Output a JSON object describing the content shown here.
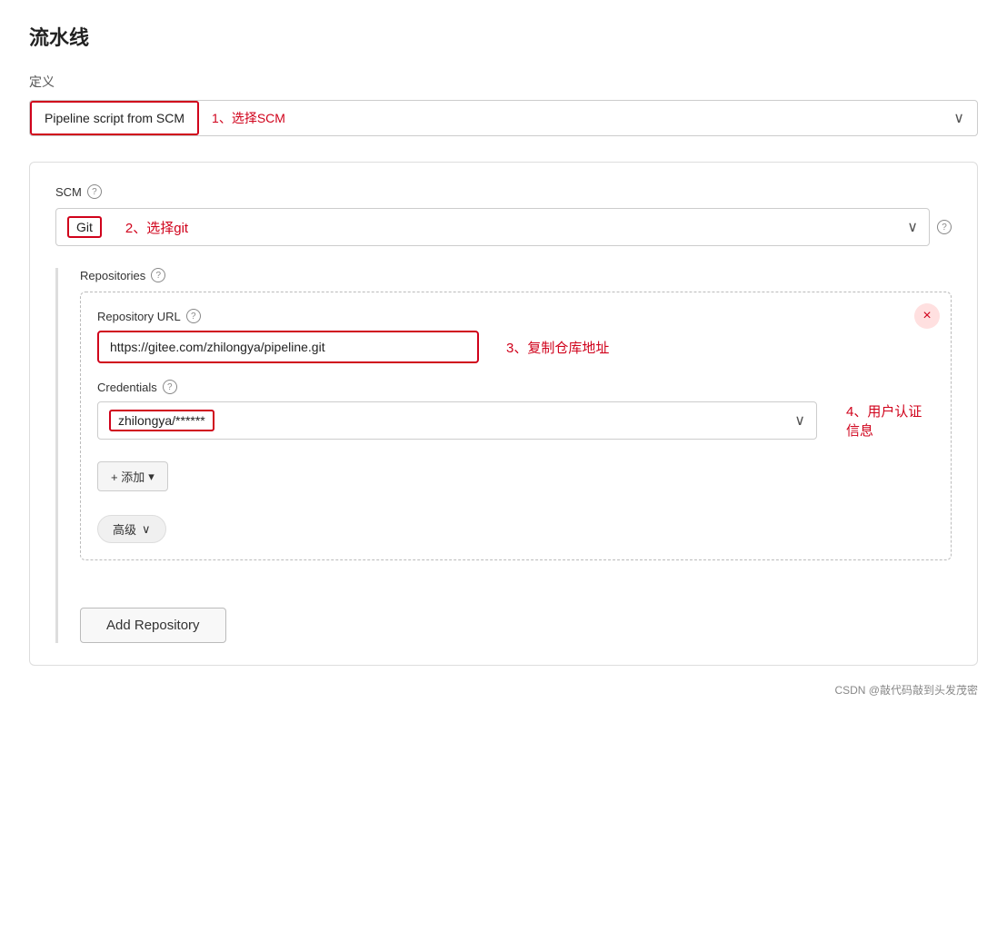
{
  "page": {
    "title": "流水线"
  },
  "definition": {
    "label": "定义",
    "dropdown_value": "Pipeline script from SCM",
    "annotation": "1、选择SCM",
    "chevron": "∨"
  },
  "scm": {
    "label": "SCM",
    "help": "?",
    "dropdown_value": "Git",
    "annotation": "2、选择git",
    "chevron": "∨",
    "help2": "?"
  },
  "repositories": {
    "label": "Repositories",
    "help": "?",
    "repo_url_label": "Repository URL",
    "repo_url_help": "?",
    "repo_url_value": "https://gitee.com/zhilongya/pipeline.git",
    "repo_url_annotation": "3、复制仓库地址",
    "credentials_label": "Credentials",
    "credentials_help": "?",
    "credentials_value": "zhilongya/******",
    "credentials_annotation": "4、用户认证信息",
    "credentials_chevron": "∨",
    "add_button_label": "+ 添加",
    "add_button_sub": "▾",
    "advanced_label": "高级",
    "advanced_chevron": "∨",
    "close_icon": "×"
  },
  "footer": {
    "add_repo_button": "Add Repository",
    "note": "CSDN @敲代码敲到头发茂密"
  }
}
